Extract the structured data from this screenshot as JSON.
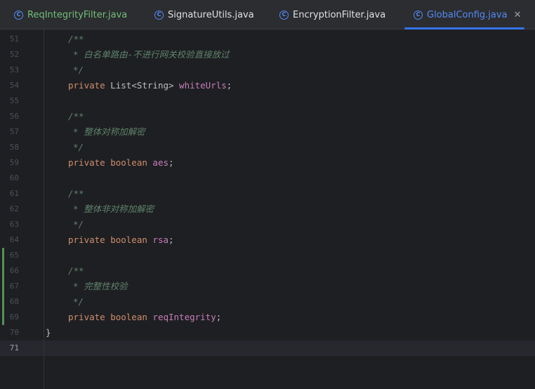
{
  "tabs": [
    {
      "label": "ReqIntegrityFilter.java",
      "icon": "class-icon",
      "icon_glyph": "C",
      "state": "modified"
    },
    {
      "label": "SignatureUtils.java",
      "icon": "class-icon",
      "icon_glyph": "C",
      "state": "normal"
    },
    {
      "label": "EncryptionFilter.java",
      "icon": "class-icon",
      "icon_glyph": "C",
      "state": "normal"
    },
    {
      "label": "GlobalConfig.java",
      "icon": "class-icon",
      "icon_glyph": "C",
      "state": "active",
      "close": "✕"
    }
  ],
  "editor": {
    "current_line": 71,
    "lines": [
      {
        "n": "51",
        "open": "/**"
      },
      {
        "n": "52",
        "star": "* ",
        "text": "白名单路由-不进行网关校验直接放过"
      },
      {
        "n": "53",
        "close": "*/"
      },
      {
        "n": "54",
        "kw": "private",
        "type": " List<String> ",
        "field": "whiteUrls",
        "end": ";"
      },
      {
        "n": "55"
      },
      {
        "n": "56",
        "open": "/**"
      },
      {
        "n": "57",
        "star": "* ",
        "text": "整体对称加解密"
      },
      {
        "n": "58",
        "close": "*/"
      },
      {
        "n": "59",
        "kw": "private boolean",
        "field": "aes",
        "end": ";"
      },
      {
        "n": "60"
      },
      {
        "n": "61",
        "open": "/**"
      },
      {
        "n": "62",
        "star": "* ",
        "text": "整体非对称加解密"
      },
      {
        "n": "63",
        "close": "*/"
      },
      {
        "n": "64",
        "kw": "private boolean",
        "field": "rsa",
        "end": ";"
      },
      {
        "n": "65"
      },
      {
        "n": "66",
        "open": "/**"
      },
      {
        "n": "67",
        "star": "* ",
        "text": "完整性校验"
      },
      {
        "n": "68",
        "close": "*/"
      },
      {
        "n": "69",
        "kw": "private boolean",
        "field": "reqIntegrity",
        "end": ";"
      },
      {
        "n": "70",
        "brace": "}"
      },
      {
        "n": "71"
      }
    ]
  },
  "colors": {
    "keyword": "#cf8e6d",
    "field": "#c77dbb",
    "comment": "#5f826b",
    "active_tab": "#548af7",
    "modified_tab": "#73bd79",
    "change_marker": "#549159"
  }
}
